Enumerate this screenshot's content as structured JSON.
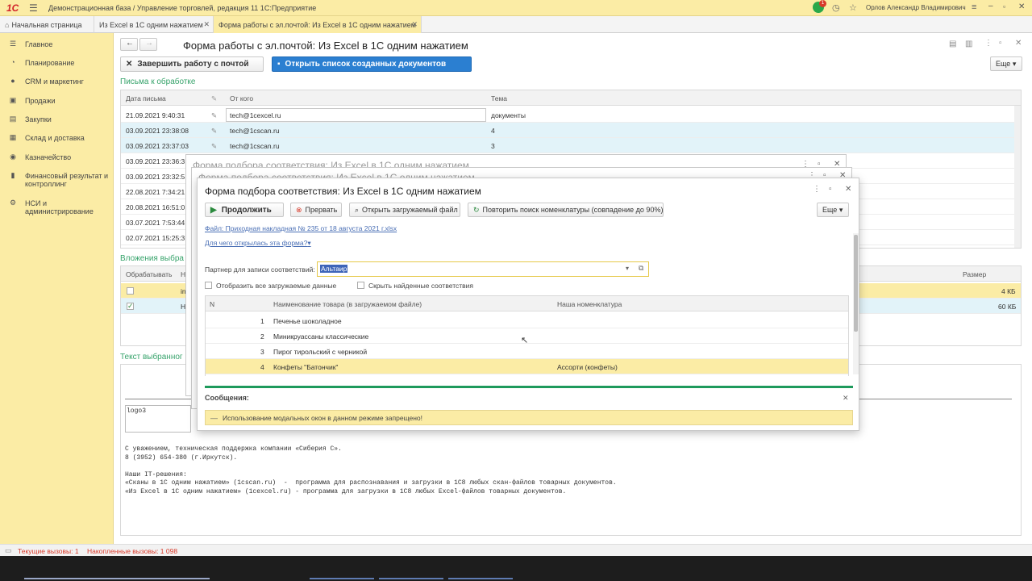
{
  "titlebar": {
    "logo": "1С",
    "title": "Демонстрационная база / Управление торговлей, редакция 11 1С:Предприятие",
    "notify_count": "1",
    "user": "Орлов Александр Владимирович"
  },
  "tabs": [
    {
      "label": "Начальная страница"
    },
    {
      "label": "Из Excel в 1С одним нажатием"
    },
    {
      "label": "Форма работы с эл.почтой: Из Excel в 1С одним нажатием"
    }
  ],
  "sidebar": {
    "items": [
      {
        "label": "Главное",
        "icon": "menu-icon"
      },
      {
        "label": "Планирование",
        "icon": "planning-icon"
      },
      {
        "label": "CRM и маркетинг",
        "icon": "crm-icon"
      },
      {
        "label": "Продажи",
        "icon": "sales-icon"
      },
      {
        "label": "Закупки",
        "icon": "purchases-icon"
      },
      {
        "label": "Склад и доставка",
        "icon": "warehouse-icon"
      },
      {
        "label": "Казначейство",
        "icon": "treasury-icon"
      },
      {
        "label": "Финансовый результат и контроллинг",
        "icon": "finance-icon"
      },
      {
        "label": "НСИ и администрирование",
        "icon": "settings-icon"
      }
    ]
  },
  "form": {
    "title": "Форма работы с эл.почтой: Из Excel в 1С одним нажатием",
    "finish_button": "Завершить работу с почтой",
    "open_list_button": "Открыть список созданных документов",
    "more_button": "Еще",
    "letters_section": "Письма к обработке",
    "letters_columns": [
      "Дата письма",
      "От кого",
      "Тема"
    ],
    "letters_rows": [
      {
        "date": "21.09.2021 9:40:31",
        "from": "tech@1cexcel.ru",
        "subject": "документы"
      },
      {
        "date": "03.09.2021 23:38:08",
        "from": "tech@1cscan.ru",
        "subject": "4"
      },
      {
        "date": "03.09.2021 23:37:03",
        "from": "tech@1cscan.ru",
        "subject": "3"
      },
      {
        "date": "03.09.2021 23:36:3",
        "from": "",
        "subject": ""
      },
      {
        "date": "03.09.2021 23:32:5",
        "from": "",
        "subject": ""
      },
      {
        "date": "22.08.2021 7:34:21",
        "from": "",
        "subject": ""
      },
      {
        "date": "20.08.2021 16:51:0",
        "from": "",
        "subject": ""
      },
      {
        "date": "03.07.2021 7:53:44",
        "from": "",
        "subject": ""
      },
      {
        "date": "02.07.2021 15:25:3",
        "from": "",
        "subject": ""
      }
    ],
    "attachments_section": "Вложения выбра",
    "attachments_columns": [
      "Обрабатывать",
      "Н",
      "Размер"
    ],
    "attachments_rows": [
      {
        "name": "in",
        "size": "4 КБ",
        "checked": false
      },
      {
        "name": "Н",
        "size": "60 КБ",
        "checked": true
      }
    ],
    "text_section": "Текст выбранног",
    "text_logo": "logo3",
    "letter_text": "С уважением, техническая поддержка компании «Сиберия С».\n8 (3952) 654-380 (г.Иркутск).\n\nНаши IT-решения:\n«Сканы в 1С одним нажатием» (1cscan.ru)  -  программа для распознавания и загрузки в 1С8 любых скан-файлов товарных документов.\n«Из Excel в 1С одним нажатием» (1cexcel.ru) - программа для загрузки в 1С8 любых Excel-файлов товарных документов."
  },
  "bg_dialog": {
    "title": "Форма подбора соответствия: Из Excel в 1С одним нажатием"
  },
  "dialog": {
    "title": "Форма подбора соответствия: Из Excel в 1С одним нажатием",
    "continue_button": "Продолжить",
    "abort_button": "Прервать",
    "open_file_button": "Открыть загружаемый файл",
    "repeat_search_button": "Повторить поиск номенклатуры (совпадение до 90%)",
    "more_button": "Еще",
    "file_link": "Файл: Приходная накладная № 235 от 18 августа 2021 г.xlsx",
    "why_link": "Для чего открылась эта форма?",
    "partner_label": "Партнер для записи соответствий:",
    "partner_value": "Альтаир",
    "show_all_label": "Отобразить все загружаемые данные",
    "hide_found_label": "Скрыть найденные соответствия",
    "columns": [
      "N",
      "Наименование товара (в загружаемом файле)",
      "Наша номенклатура"
    ],
    "rows": [
      {
        "n": "1",
        "name": "Печенье шоколадное",
        "ours": ""
      },
      {
        "n": "2",
        "name": "Миникруассаны классические",
        "ours": ""
      },
      {
        "n": "3",
        "name": "Пирог тирольский с черникой",
        "ours": ""
      },
      {
        "n": "4",
        "name": "Конфеты \"Батончик\"",
        "ours": "Ассорти (конфеты)"
      }
    ],
    "messages_title": "Сообщения:",
    "message_text": "Использование модальных окон в данном режиме запрещено!"
  },
  "statusbar": {
    "current_calls": "Текущие вызовы:  1",
    "accumulated_calls": "Накопленные вызовы:  1 098"
  },
  "colors": {
    "accent_yellow": "#fbeca5",
    "primary_blue": "#2b7fd1",
    "section_green": "#37a36b",
    "progress_green": "#1e9a5c"
  }
}
